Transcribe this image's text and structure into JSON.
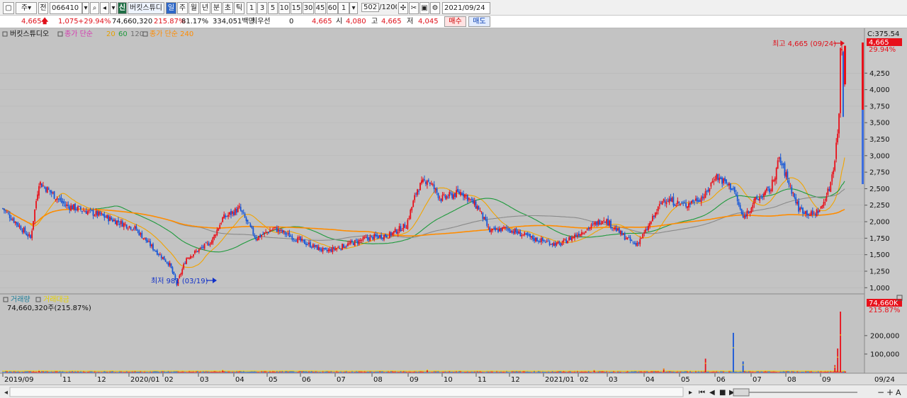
{
  "toolbar": {
    "period_tabs": [
      "주",
      "월",
      "년",
      "분",
      "초",
      "틱"
    ],
    "period_active": "일",
    "numbers": [
      "1",
      "3",
      "5",
      "10",
      "15",
      "30",
      "45",
      "60"
    ],
    "code": "066410",
    "market_label": "전",
    "company_badge": "신",
    "company_name": "버킷스튜디",
    "view_left": "주",
    "count_dropdown": "1",
    "count_value": "502",
    "count_max": "/1200",
    "date_value": "2021/09/24"
  },
  "quote": {
    "price": "4,665",
    "change": "1,075",
    "change_pct": "+29.94%",
    "volume": "74,660,320",
    "volume_ratio": "215.87%",
    "turnover": "81.17%",
    "amount": "334,051백만",
    "best_bid_label": "최우선",
    "best_bid_value": "0",
    "last": "4,665",
    "open_label": "시",
    "open": "4,080",
    "high_label": "고",
    "high": "4,665",
    "low_label": "저",
    "low": "4,045",
    "buy_label": "매수",
    "sell_label": "매도"
  },
  "price_legend": {
    "name": "버킷스튜디오",
    "ma_label": "종가 단순",
    "ma_periods": [
      "20",
      "60",
      "120"
    ],
    "ma_long_label": "종가 단순 240"
  },
  "annotations": {
    "high_label": "최고 4,665 (09/24)",
    "low_label": "최저 981 (03/19)",
    "cursor_label": "C:375.54",
    "last_price_tag": "4,665",
    "last_pct_tag": "29.94%"
  },
  "volume_legend": {
    "title_a": "거래량",
    "title_b": "거래대금",
    "value": "74,660,320주(215.87%)",
    "tag_value": "74,660K",
    "tag_pct": "215.87%"
  },
  "colors": {
    "up": "#e8101a",
    "down": "#1556d8",
    "ma20": "#f2a400",
    "ma60": "#1e9a3c",
    "ma120": "#8a8a8a",
    "ma240": "#ff8c00",
    "bg": "#c3c3c3"
  },
  "chart_data": {
    "type": "candlestick",
    "title": "버킷스튜디오",
    "price_axis": {
      "ticks": [
        "4,250",
        "4,000",
        "3,750",
        "3,500",
        "3,250",
        "3,000",
        "2,750",
        "2,500",
        "2,250",
        "2,000",
        "1,750",
        "1,500",
        "1,250",
        "1,000"
      ],
      "range": [
        960,
        4800
      ]
    },
    "volume_axis": {
      "ticks": [
        "200,000",
        "100,000"
      ],
      "range": [
        0,
        330000
      ]
    },
    "x_ticks": [
      "2019/09",
      "11",
      "12",
      "2020/01",
      "02",
      "03",
      "04",
      "05",
      "06",
      "07",
      "08",
      "09",
      "10",
      "11",
      "12",
      "2021/01",
      "02",
      "03",
      "04",
      "05",
      "06",
      "07",
      "08",
      "09",
      "09/24"
    ],
    "price_anchors": [
      [
        0,
        2200
      ],
      [
        20,
        1750
      ],
      [
        26,
        2600
      ],
      [
        45,
        2250
      ],
      [
        70,
        2100
      ],
      [
        95,
        1900
      ],
      [
        108,
        1600
      ],
      [
        120,
        1350
      ],
      [
        125,
        1050
      ],
      [
        132,
        1450
      ],
      [
        150,
        1700
      ],
      [
        158,
        2050
      ],
      [
        170,
        2200
      ],
      [
        182,
        1750
      ],
      [
        195,
        1900
      ],
      [
        215,
        1700
      ],
      [
        232,
        1550
      ],
      [
        240,
        1600
      ],
      [
        262,
        1750
      ],
      [
        278,
        1800
      ],
      [
        290,
        1950
      ],
      [
        298,
        2500
      ],
      [
        305,
        2650
      ],
      [
        315,
        2350
      ],
      [
        330,
        2450
      ],
      [
        342,
        2200
      ],
      [
        350,
        1850
      ],
      [
        362,
        1900
      ],
      [
        380,
        1750
      ],
      [
        400,
        1650
      ],
      [
        412,
        1800
      ],
      [
        425,
        1950
      ],
      [
        432,
        2050
      ],
      [
        445,
        1800
      ],
      [
        455,
        1650
      ],
      [
        462,
        1850
      ],
      [
        475,
        2350
      ],
      [
        490,
        2250
      ],
      [
        505,
        2400
      ],
      [
        512,
        2700
      ],
      [
        525,
        2500
      ],
      [
        532,
        2050
      ],
      [
        540,
        2300
      ],
      [
        552,
        2500
      ],
      [
        558,
        2950
      ],
      [
        563,
        2700
      ],
      [
        572,
        2200
      ],
      [
        582,
        2100
      ],
      [
        588,
        2200
      ],
      [
        594,
        2500
      ],
      [
        598,
        2950
      ],
      [
        601,
        3600
      ],
      [
        602,
        4665
      ]
    ],
    "volume_spikes": [
      [
        26,
        9000
      ],
      [
        158,
        12000
      ],
      [
        305,
        14000
      ],
      [
        425,
        12000
      ],
      [
        475,
        22000
      ],
      [
        505,
        75000
      ],
      [
        525,
        215000
      ],
      [
        532,
        60000
      ],
      [
        598,
        40000
      ],
      [
        600,
        130000
      ],
      [
        602,
        330000
      ]
    ],
    "high_point": {
      "date": "09/24",
      "value": 4665
    },
    "low_point": {
      "date": "03/19",
      "value": 981
    },
    "moving_averages": [
      "20",
      "60",
      "120",
      "240"
    ]
  }
}
